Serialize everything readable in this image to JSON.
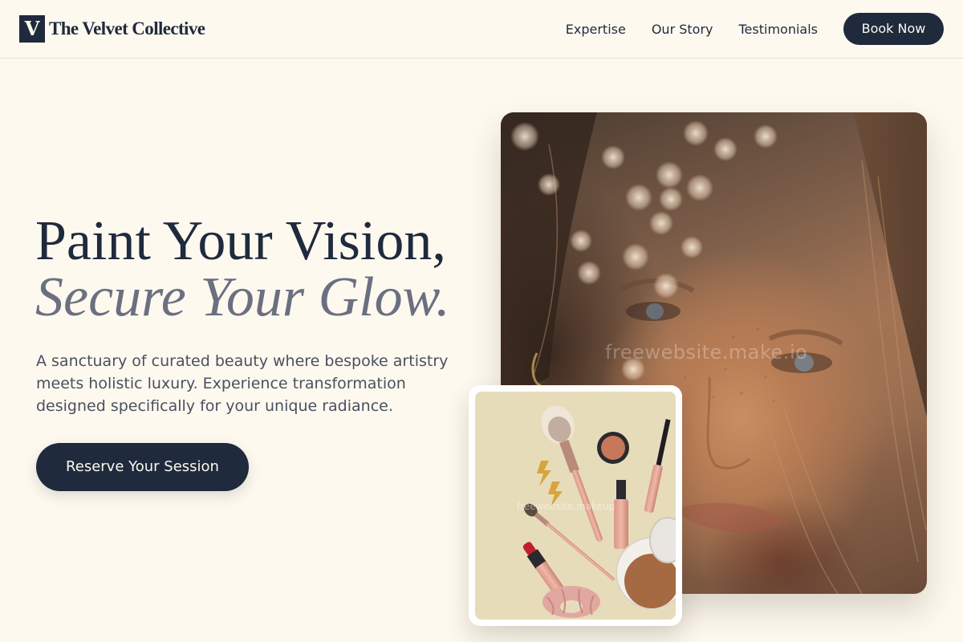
{
  "brand": {
    "mark": "V",
    "name": "The Velvet Collective"
  },
  "nav": {
    "items": [
      "Expertise",
      "Our Story",
      "Testimonials"
    ],
    "book_label": "Book Now"
  },
  "hero": {
    "headline_line1": "Paint Your Vision,",
    "headline_line2": "Secure Your Glow.",
    "description": "A sanctuary of curated beauty where bespoke artistry meets holistic luxury. Experience transformation designed specifically for your unique radiance.",
    "cta_label": "Reserve Your Session"
  },
  "images": {
    "portrait_watermark": "freewebsite.make.io",
    "products_watermark": "freewebsite.makeup"
  },
  "colors": {
    "background": "#fdf9ef",
    "navy": "#1f2a3d",
    "muted_slate": "#6b7080"
  }
}
